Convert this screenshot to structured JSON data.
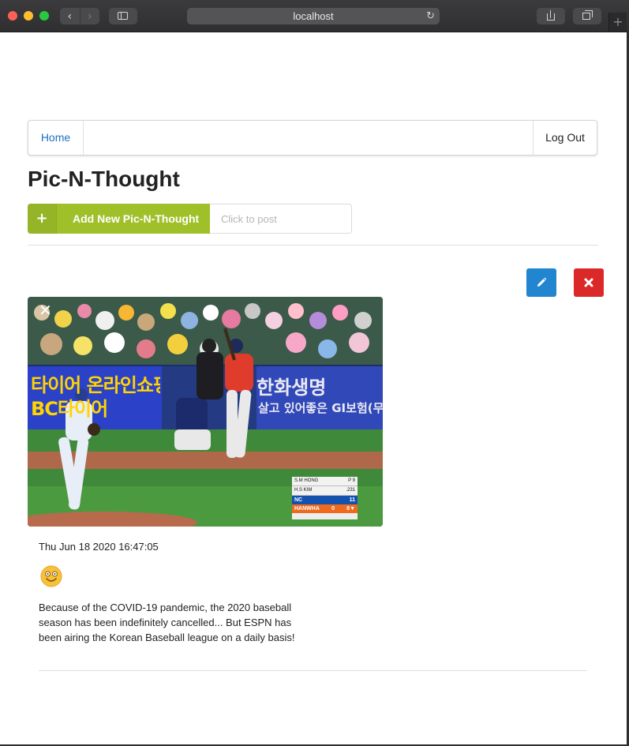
{
  "browser": {
    "url": "localhost",
    "back_icon": "chevron-left-icon",
    "forward_icon": "chevron-right-icon",
    "reload_icon": "reload-icon",
    "new_tab_label": "+"
  },
  "navbar": {
    "home_label": "Home",
    "logout_label": "Log Out"
  },
  "page": {
    "title": "Pic-N-Thought"
  },
  "post_form": {
    "add_label": "Add New Pic-N-Thought",
    "add_icon": "plus-icon",
    "input_placeholder": "Click to post",
    "input_value": ""
  },
  "actions": {
    "edit_icon": "pencil-icon",
    "delete_icon": "close-icon"
  },
  "post": {
    "close_glyph": "✕",
    "photo_banner_left_1": "타이어 온라인쇼핑몰",
    "photo_banner_left_2": "BC타이어",
    "photo_banner_right_1": "한화생명",
    "photo_banner_right_2": "살고 있어좋은 GI보험(무)",
    "score_pitcher": "S.M HONG",
    "score_pitcher_stat": "P  9",
    "score_batter": "H.S KIM",
    "score_batter_stat": ".231",
    "score_team1": "NC",
    "score_team1_runs": "11",
    "score_team2": "HANWHA",
    "score_team2_runs": "0",
    "score_inning": "8▼",
    "date": "Thu Jun 18 2020 16:47:05",
    "mood_icon": "smiling-face-icon",
    "text": "Because of the COVID-19 pandemic, the 2020 baseball season has been indefinitely cancelled... But ESPN has been airing the Korean Baseball league on a daily basis!"
  },
  "colors": {
    "accent_green": "#a0c02a",
    "edit_blue": "#2185d0",
    "delete_red": "#db2828",
    "link_blue": "#1e70bf"
  }
}
